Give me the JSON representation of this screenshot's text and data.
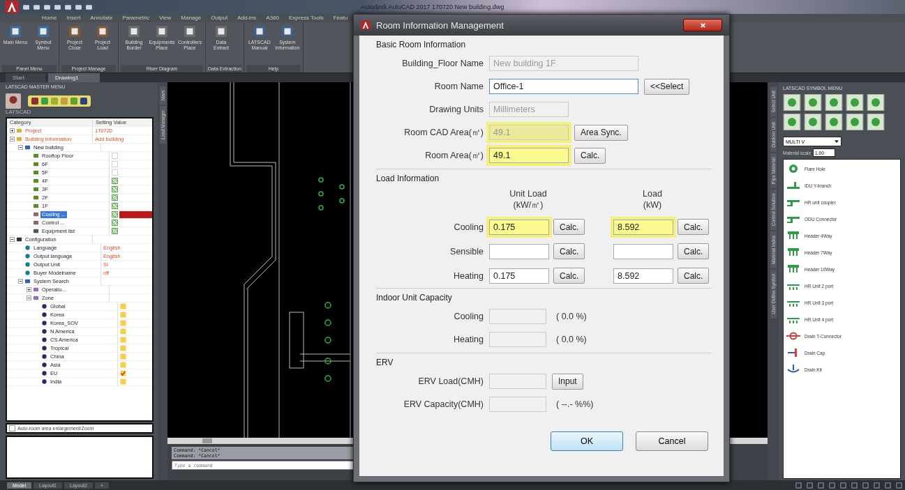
{
  "app": {
    "title": "Autodesk AutoCAD 2017   170720 New building.dwg"
  },
  "ribbon_tabs": [
    {
      "label": "Home",
      "selected": false
    },
    {
      "label": "Insert",
      "selected": false
    },
    {
      "label": "Annotate",
      "selected": false
    },
    {
      "label": "Parametric",
      "selected": false
    },
    {
      "label": "View",
      "selected": false
    },
    {
      "label": "Manage",
      "selected": false
    },
    {
      "label": "Output",
      "selected": false
    },
    {
      "label": "Add-ins",
      "selected": false
    },
    {
      "label": "A360",
      "selected": false
    },
    {
      "label": "Express Tools",
      "selected": false
    },
    {
      "label": "Featu",
      "selected": false
    }
  ],
  "ribbon_groups": [
    {
      "label": "Panel Menu",
      "buttons": [
        "Main Menu",
        "Symbol Menu"
      ]
    },
    {
      "label": "Project Manage",
      "buttons": [
        "Project Close",
        "Project Load"
      ]
    },
    {
      "label": "Riser Diagram",
      "buttons": [
        "Building Border",
        "Equipments Place",
        "Controllers Place"
      ]
    },
    {
      "label": "Data Extraction",
      "buttons": [
        "Data Extract"
      ]
    },
    {
      "label": "Help",
      "buttons": [
        "LATSCAD Manual",
        "System Information"
      ]
    }
  ],
  "doc_tabs": [
    {
      "label": "Start",
      "selected": false
    },
    {
      "label": "Drawing1",
      "selected": true
    }
  ],
  "left_palette": {
    "title": "LATSCAD MASTER MENU",
    "logo_label": "LATSCAD",
    "side_tabs": [
      "Main",
      "Load Manager"
    ],
    "tree": {
      "columns": [
        "Category",
        "Setting Value"
      ],
      "rows": [
        {
          "label": "Project",
          "kind": "group",
          "value": "170720",
          "expanded": false,
          "selected": false
        },
        {
          "label": "Building Information",
          "kind": "group",
          "value": "Add building",
          "expanded": true,
          "selected": false,
          "children": [
            {
              "label": "New building",
              "kind": "building",
              "expanded": true,
              "selected": false,
              "children": [
                {
                  "label": "Rooftop Floor",
                  "kind": "floor",
                  "completed": false,
                  "selected": false
                },
                {
                  "label": "6F",
                  "kind": "floor",
                  "completed": false,
                  "selected": false
                },
                {
                  "label": "5F",
                  "kind": "floor",
                  "completed": false,
                  "selected": false
                },
                {
                  "label": "4F",
                  "kind": "floor",
                  "completed": true,
                  "selected": false
                },
                {
                  "label": "3F",
                  "kind": "floor",
                  "completed": true,
                  "selected": false
                },
                {
                  "label": "2F",
                  "kind": "floor",
                  "completed": true,
                  "selected": false
                },
                {
                  "label": "1F",
                  "kind": "floor",
                  "completed": true,
                  "selected": false
                },
                {
                  "label": "Cooling ...",
                  "kind": "tool",
                  "completed": true,
                  "selected": true
                },
                {
                  "label": "Control ...",
                  "kind": "tool",
                  "completed": true,
                  "selected": false
                },
                {
                  "label": "Equipment list",
                  "kind": "list",
                  "completed": true,
                  "selected": false
                }
              ]
            }
          ]
        },
        {
          "label": "Configuration",
          "kind": "config",
          "expanded": true,
          "selected": false,
          "children": [
            {
              "label": "Language",
              "kind": "setting",
              "value": "English",
              "selected": false
            },
            {
              "label": "Output language",
              "kind": "setting",
              "value": "English",
              "selected": false
            },
            {
              "label": "Output Unit",
              "kind": "setting",
              "value": "SI",
              "selected": false
            },
            {
              "label": "Buyer Modelname",
              "kind": "setting",
              "value": "off",
              "selected": false
            },
            {
              "label": "System Search",
              "kind": "search",
              "expanded": true,
              "selected": false,
              "children": [
                {
                  "label": "Operatio...",
                  "kind": "zonegroup",
                  "expanded": false,
                  "selected": false
                },
                {
                  "label": "Zone",
                  "kind": "zonegroup",
                  "expanded": true,
                  "selected": false,
                  "children": [
                    {
                      "label": "Global",
                      "kind": "zone",
                      "checked": false,
                      "selected": false
                    },
                    {
                      "label": "Korea",
                      "kind": "zone",
                      "checked": false,
                      "selected": false
                    },
                    {
                      "label": "Korea_SOV",
                      "kind": "zone",
                      "checked": false,
                      "selected": false
                    },
                    {
                      "label": "N America",
                      "kind": "zone",
                      "checked": false,
                      "selected": false
                    },
                    {
                      "label": "CS America",
                      "kind": "zone",
                      "checked": false,
                      "selected": false
                    },
                    {
                      "label": "Tropical",
                      "kind": "zone",
                      "checked": false,
                      "selected": false
                    },
                    {
                      "label": "China",
                      "kind": "zone",
                      "checked": false,
                      "selected": false
                    },
                    {
                      "label": "Asia",
                      "kind": "zone",
                      "checked": false,
                      "selected": false
                    },
                    {
                      "label": "EU",
                      "kind": "zone",
                      "checked": true,
                      "selected": false
                    },
                    {
                      "label": "India",
                      "kind": "zone",
                      "checked": false,
                      "selected": false
                    }
                  ]
                }
              ]
            }
          ]
        }
      ]
    },
    "auto_zoom": {
      "label": "Auto-room area enlargement/Zoom",
      "checked": false
    }
  },
  "command_line": {
    "history": [
      "Command: *Cancel*",
      "Command: *Cancel*"
    ],
    "placeholder": "Type a command"
  },
  "layout_tabs": [
    {
      "label": "Model",
      "selected": true
    },
    {
      "label": "Layout1",
      "selected": false
    },
    {
      "label": "Layout2",
      "selected": false
    },
    {
      "label": "+",
      "selected": false
    }
  ],
  "right_palette": {
    "title": "LATSCAD SYMBOL MENU",
    "side_tabs": [
      "Select Unit",
      "Outdoor Unit",
      "Pipe Material",
      "Control Solution",
      "Material Index",
      "User Define Symbol"
    ],
    "system": "MULTI V",
    "scale_label": "Material scale",
    "scale": "1.00",
    "symbols": [
      {
        "label": "Flare Hole",
        "kind": "hole",
        "color": "#2e9a4a"
      },
      {
        "label": "IDU Y-branch",
        "kind": "branch",
        "color": "#2e9a4a"
      },
      {
        "label": "HR unit coupler",
        "kind": "coupler",
        "color": "#2e9a4a"
      },
      {
        "label": "ODU Connector",
        "kind": "coupler",
        "color": "#2e9a4a"
      },
      {
        "label": "Header 4Way",
        "kind": "header",
        "color": "#2e9a4a"
      },
      {
        "label": "Header 7Way",
        "kind": "header",
        "color": "#2e9a4a"
      },
      {
        "label": "Header 10Way",
        "kind": "header",
        "color": "#2e9a4a"
      },
      {
        "label": "HR Unit 2 port",
        "kind": "port",
        "color": "#2e9a4a"
      },
      {
        "label": "HR Unit 3 port",
        "kind": "port",
        "color": "#2e9a4a"
      },
      {
        "label": "HR Unit 4 port",
        "kind": "port",
        "color": "#2e9a4a"
      },
      {
        "label": "Drain T-Connector",
        "kind": "tee",
        "color": "#d0403a"
      },
      {
        "label": "Drain Cap",
        "kind": "cap",
        "color": "#2a5fb8"
      },
      {
        "label": "Drain Kit",
        "kind": "kit",
        "color": "#2a5fb8"
      }
    ]
  },
  "dialog": {
    "title": "Room Information Management",
    "basic": {
      "title": "Basic Room Information",
      "rows": [
        {
          "label": "Building_Floor Name",
          "kind": "long",
          "value": "New building 1F",
          "disabled": true,
          "highlighted": false
        },
        {
          "label": "Room Name",
          "kind": "long",
          "value": "Office-1",
          "disabled": false,
          "focused": true,
          "highlighted": false,
          "button": "<<Select"
        },
        {
          "label": "Drawing Units",
          "kind": "short",
          "value": "Millimeters",
          "disabled": true,
          "highlighted": false
        },
        {
          "label": "Room CAD Area(㎡)",
          "kind": "short",
          "value": "49.1",
          "disabled": true,
          "highlighted": true,
          "button": "Area Sync."
        },
        {
          "label": "Room Area(㎡)",
          "kind": "short",
          "value": "49.1",
          "disabled": false,
          "highlighted": true,
          "button": "Calc."
        }
      ]
    },
    "load": {
      "title": "Load Information",
      "headers": [
        {
          "title": "Unit Load",
          "unit": "(kW/㎡)"
        },
        {
          "title": "Load",
          "unit": "(kW)"
        }
      ],
      "rows": [
        {
          "label": "Cooling",
          "cells": [
            {
              "value": "0.175",
              "highlighted": true,
              "button": "Calc."
            },
            {
              "value": "8.592",
              "highlighted": true,
              "button": "Calc."
            }
          ]
        },
        {
          "label": "Sensible",
          "cells": [
            {
              "highlighted": false,
              "button": "Calc."
            },
            {
              "highlighted": false,
              "button": "Calc."
            }
          ]
        },
        {
          "label": "Heating",
          "cells": [
            {
              "value": "0.175",
              "highlighted": false,
              "button": "Calc."
            },
            {
              "value": "8.592",
              "highlighted": false,
              "button": "Calc."
            }
          ]
        }
      ]
    },
    "capacity": {
      "title": "Indoor Unit Capacity",
      "rows": [
        {
          "label": "Cooling",
          "disabled": true,
          "reading": "( 0.0 %)"
        },
        {
          "label": "Heating",
          "disabled": true,
          "reading": "( 0.0 %)"
        }
      ]
    },
    "erv": {
      "title": "ERV",
      "rows": [
        {
          "label": "ERV Load(CMH)",
          "disabled": true,
          "button": "Input"
        },
        {
          "label": "ERV Capacity(CMH)",
          "disabled": true,
          "reading": "( --.- %%)"
        }
      ]
    },
    "buttons": [
      {
        "label": "OK",
        "default": true
      },
      {
        "label": "Cancel",
        "default": false
      }
    ]
  }
}
